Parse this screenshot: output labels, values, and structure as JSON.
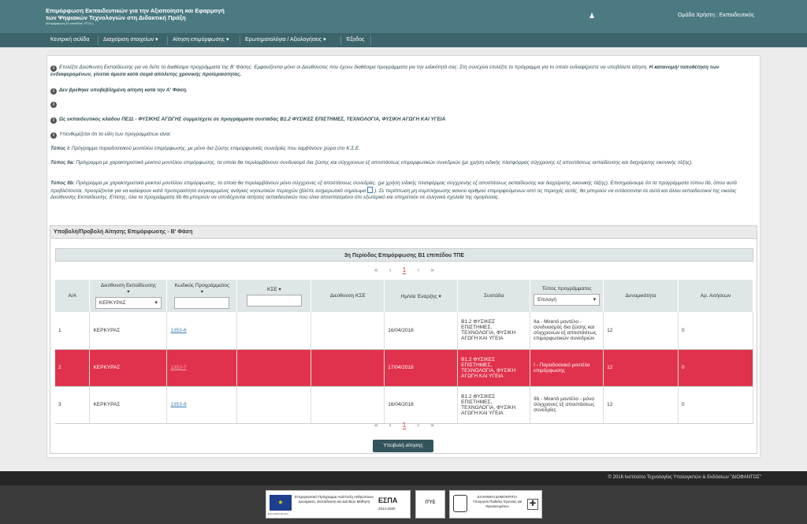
{
  "header": {
    "title": "Επιμόρφωση Εκπαιδευτικών για την Αξιοποίηση και Εφαρμογή των Ψηφιακών Τεχνολογιών στη Διδακτική Πράξη",
    "subtitle": "(Επιμόρφωση Β' επιπέδου Τ.Π.Ε.)",
    "user_icon": "user-icon",
    "user_group": "Ομάδα Χρήστη : Εκπαιδευτικός"
  },
  "nav": {
    "items": [
      "Κεντρική σελίδα",
      "Διαχείριση στοιχείων",
      "Αίτηση επιμόρφωσης",
      "Ερωτηματολόγια / Αξιολογήσεις",
      "Έξοδος"
    ]
  },
  "info": {
    "p1a": "Επιλέξτε Διεύθυνση Εκπαίδευσης για να δείτε τα διαθέσιμα προγράμματα της Β' Φάσης. Εμφανίζονται μόνο οι Διευθύνσεις που έχουν διαθέσιμα προγράμματα για την ειδικότητά σας. Στη συνέχεια επιλέξτε το πρόγραμμα για το οποίο ενδιαφέρεστε να υποβάλετε αίτηση.",
    "p1b": "Η κατανομή/ τοποθέτηση των ενδιαφερομένων, γίνεται άμεσα κατά σειρά απόλυτης χρονικής προτεραιότητας.",
    "p2": "Δεν βρέθηκε υποβεβλημένη αίτηση κατά την Α' Φάση.",
    "p3": "Ως εκπαιδευτικός κλάδου ΠΕ11 - ΦΥΣΙΚΗΣ ΑΓΩΓΗΣ συμμετέχετε σε προγράμματα συστάδας Β1.2 ΦΥΣΙΚΕΣ ΕΠΙΣΤΗΜΕΣ, ΤΕΧΝΟΛΟΓΙΑ, ΦΥΣΙΚΗ ΑΓΩΓΗ ΚΑΙ ΥΓΕΙΑ",
    "p4": "Υπενθυμίζεται ότι τα είδη των προγραμμάτων είναι:",
    "t1_label": "Τύπος I:",
    "t1": "Πρόγραμμα παραδοσιακού μοντέλου επιμόρφωσης, με μόνο δια ζώσης επιμορφωτικές συνεδρίες που λαμβάνουν χώρα στο Κ.Σ.Ε.",
    "t2_label": "Τύπος IIa:",
    "t2": "Πρόγραμμα με χαρακτηριστικά μεικτού μοντέλου επιμόρφωσης, τα οποία θα περιλαμβάνουν συνδυασμό δια ζώσης και σύγχρονων εξ αποστάσεως επιμορφωτικών συνεδριών (με χρήση ειδικής πλατφόρμας σύγχρονης εξ αποστάσεως εκπαίδευσης και διαχείρισης εικονικής τάξης).",
    "t3_label": "Τύπος IIb:",
    "t3": "Πρόγραμμα με χαρακτηριστικά μεικτού μοντέλου επιμόρφωσης, τα οποία θα περιλαμβάνουν μόνο σύγχρονες εξ αποστάσεως συνεδρίες. (με χρήση ειδικής πλατφόρμας σύγχρονης εξ αποστάσεως εκπαίδευσης και διαχείρισης εικονικής τάξης).",
    "t3b": "Επισημαίνουμε ότι τα προγράμματα τύπου IIb, όπου αυτά προβλέπονται, προορίζονται για να καλύψουν κατά προτεραιότητα συγκεκριμένες ανάγκες νησιωτικών περιοχών (βλέπε ενημερωτικό σημείωμα",
    "t3c": "). Σε περίπτωση μη συμπλήρωσης ικανού αριθμού επιμορφούμενων από τις περιοχές αυτές, θα μπορούν να εντάσσονται σε αυτά και άλλοι εκπαιδευτικοί της οικείας Διεύθυνσης Εκπαίδευσης. Επίσης, όλα τα προγράμματα IIb θα μπορούν να υποδέχονται αιτήσεις εκπαιδευτικών που είναι αποσπασμένοι στο εξωτερικό και υπηρετούν σε ελληνικά σχολεία της ομογένειας."
  },
  "section_title": "Υποβολή/Προβολή Αίτησης Επιμόρφωσης - Β' Φάση",
  "table": {
    "caption": "3η Περίοδος Επιμόρφωσης Β1 επιπέδου ΤΠΕ",
    "pager": {
      "first": "«",
      "prev": "‹",
      "current": "1",
      "next": "›",
      "last": "»"
    },
    "headers": [
      "Α/Α",
      "Διεύθυνση Εκπαίδευσης",
      "Κωδικός Προγράμματος",
      "ΚΣΕ",
      "Διεύθυνση ΚΣΕ",
      "Ημ/νία Έναρξης",
      "Συστάδα",
      "Τύπος προγράμματος",
      "Δυναμικότητα",
      "Αρ. Αιτήσεων"
    ],
    "filter_dir": "ΚΕΡΚΥΡΑΣ",
    "filter_type": "Επιλογή",
    "rows": [
      {
        "aa": "1",
        "dir": "ΚΕΡΚΥΡΑΣ",
        "code": "1353-6",
        "kse": "",
        "kse_addr": "",
        "date": "16/04/2018",
        "cluster": "Β1.2 ΦΥΣΙΚΕΣ ΕΠΙΣΤΗΜΕΣ, ΤΕΧΝΟΛΟΓΙΑ, ΦΥΣΙΚΗ ΑΓΩΓΗ ΚΑΙ ΥΓΕΙΑ",
        "type": "IIa - Μεικτό μοντέλο - συνδυασμός δια ζώσης και σύγχρονων εξ αποστάσεως επιμορφωτικών συνεδριών",
        "capacity": "12",
        "apps": "0"
      },
      {
        "aa": "2",
        "dir": "ΚΕΡΚΥΡΑΣ",
        "code": "1353-7",
        "kse": "",
        "kse_addr": "",
        "date": "17/04/2018",
        "cluster": "Β1.2 ΦΥΣΙΚΕΣ ΕΠΙΣΤΗΜΕΣ, ΤΕΧΝΟΛΟΓΙΑ, ΦΥΣΙΚΗ ΑΓΩΓΗ ΚΑΙ ΥΓΕΙΑ",
        "type": "I - Παραδοσιακό μοντέλο επιμόρφωσης",
        "capacity": "12",
        "apps": "0"
      },
      {
        "aa": "3",
        "dir": "ΚΕΡΚΥΡΑΣ",
        "code": "1353-8",
        "kse": "",
        "kse_addr": "",
        "date": "16/04/2018",
        "cluster": "Β1.2 ΦΥΣΙΚΕΣ ΕΠΙΣΤΗΜΕΣ, ΤΕΧΝΟΛΟΓΙΑ, ΦΥΣΙΚΗ ΑΓΩΓΗ ΚΑΙ ΥΓΕΙΑ",
        "type": "IIb - Μεικτό μοντέλο - μόνο σύγχρονες εξ αποστάσεως συνεδρίες",
        "capacity": "12",
        "apps": "0"
      }
    ]
  },
  "submit_label": "Υποβολή αίτησης",
  "footer": {
    "copyright": "© 2016 Ινστιτούτο Τεχνολογίας Υπολογιστών & Εκδόσεων \"ΔΙΟΦΑΝΤΟΣ\"",
    "logo1_text": "Επιχειρησιακό Πρόγραμμα Ανάπτυξη Ανθρώπινου Δυναμικού, Εκπαίδευση και Διά Βίου Μάθηση",
    "logo1_espa": "ΕΣΠΑ",
    "logo1_years": "2014-2020",
    "logo1_eu": "Ευρωπαϊκή Ένωση",
    "logo2_text": "ΙΤΥΕ",
    "logo3_text": "ΕΛΛΗΝΙΚΗ ΔΗΜΟΚΡΑΤΙΑ Υπουργείο Παιδείας Έρευνας και Θρησκευμάτων"
  }
}
